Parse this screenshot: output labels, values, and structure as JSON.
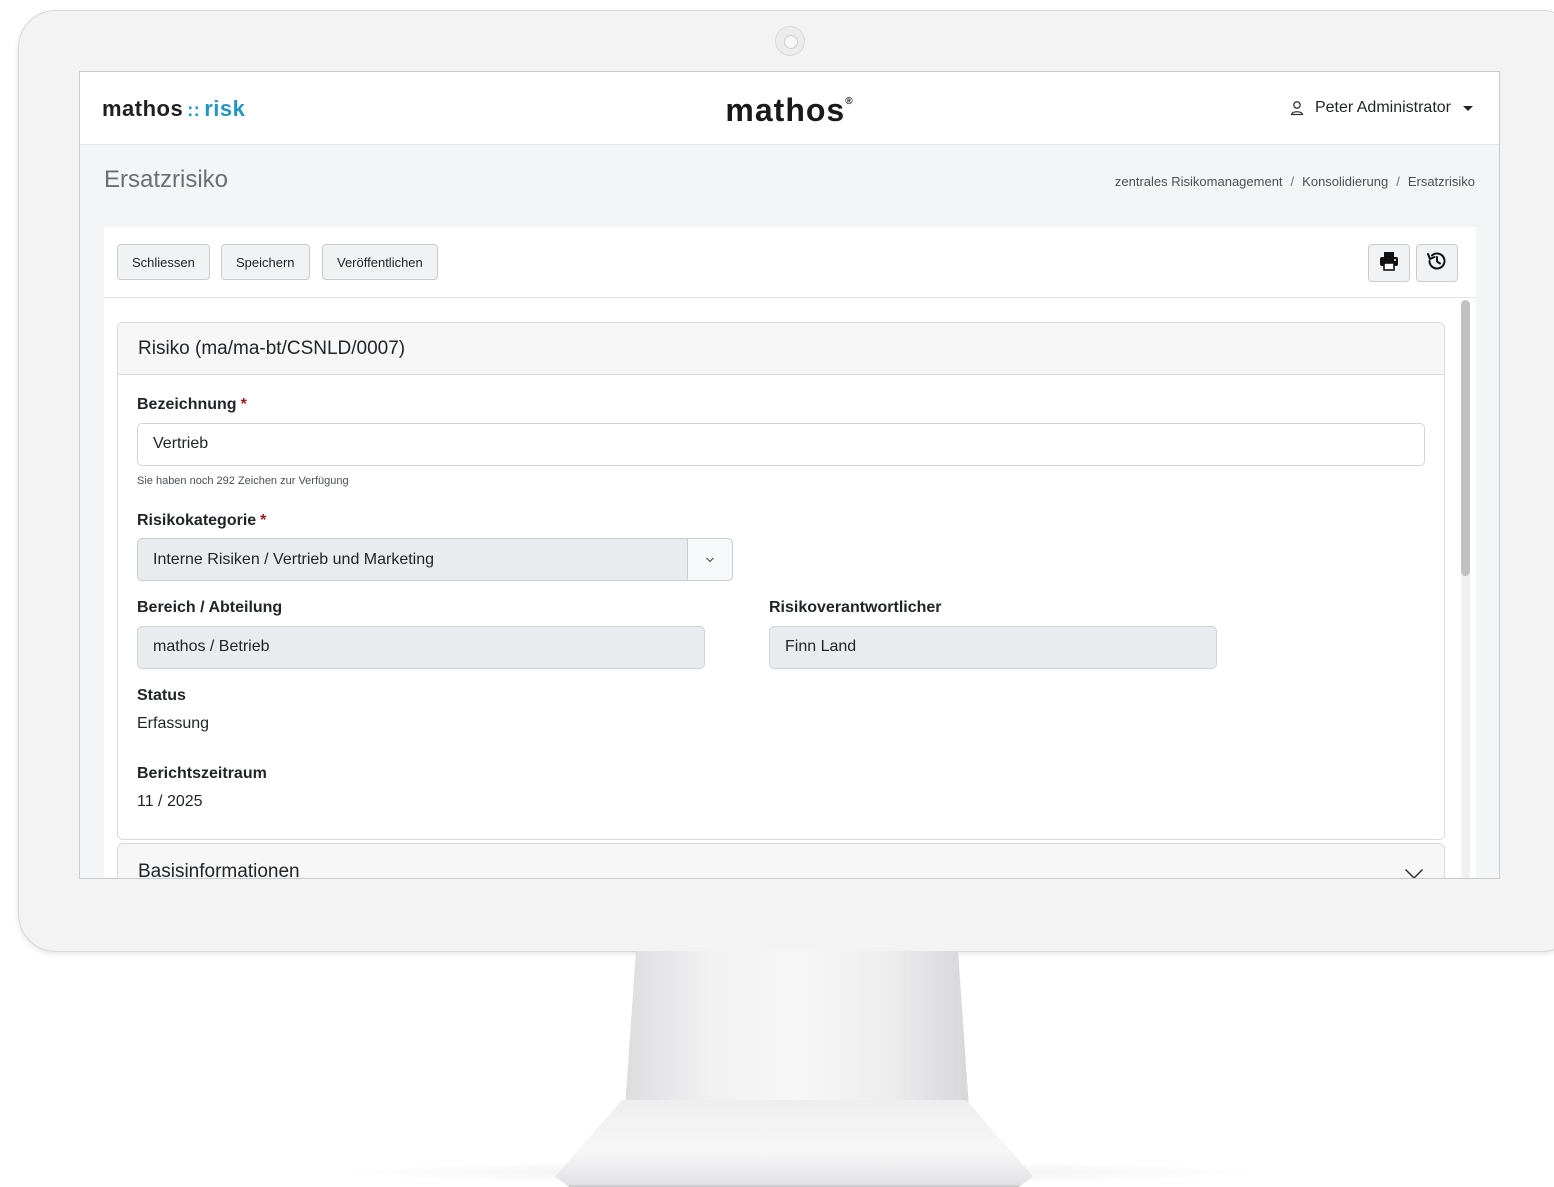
{
  "header": {
    "logo_left_main": "mathos",
    "logo_left_sep": "::",
    "logo_left_accent": "risk",
    "logo_center": "mathos",
    "logo_center_mark": "®",
    "user_name": "Peter Administrator"
  },
  "page": {
    "title": "Ersatzrisiko",
    "breadcrumb": [
      "zentrales Risikomanagement",
      "Konsolidierung",
      "Ersatzrisiko"
    ]
  },
  "toolbar": {
    "close_label": "Schliessen",
    "save_label": "Speichern",
    "publish_label": "Veröffentlichen",
    "print_icon": "print-icon",
    "history_icon": "history-icon"
  },
  "risk_card": {
    "title": "Risiko (ma/ma-bt/CSNLD/0007)",
    "bezeichnung_label": "Bezeichnung",
    "required_mark": "*",
    "bezeichnung_value": "Vertrieb",
    "bezeichnung_hint": "Sie haben noch 292 Zeichen zur Verfügung",
    "kategorie_label": "Risikokategorie",
    "kategorie_value": "Interne Risiken / Vertrieb und Marketing",
    "bereich_label": "Bereich / Abteilung",
    "bereich_value": "mathos / Betrieb",
    "verantwortlicher_label": "Risikoverantwortlicher",
    "verantwortlicher_value": "Finn Land",
    "status_label": "Status",
    "status_value": "Erfassung",
    "zeitraum_label": "Berichtszeitraum",
    "zeitraum_value": "11 / 2025"
  },
  "sections": {
    "basisinformationen": "Basisinformationen"
  },
  "colors": {
    "accent": "#2596be",
    "required": "#9b1c1c"
  }
}
